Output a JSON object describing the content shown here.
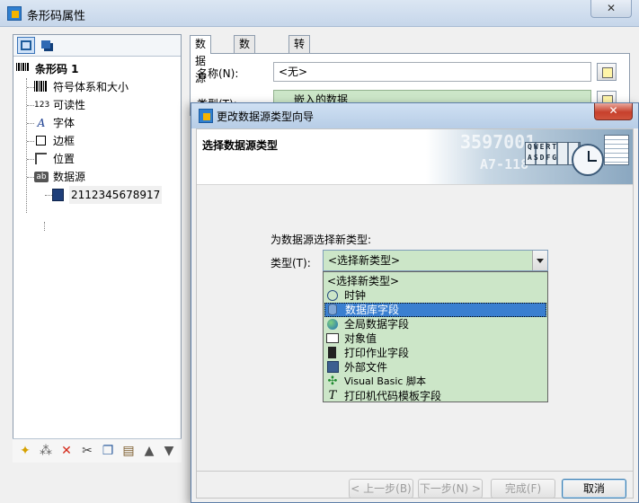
{
  "outer": {
    "title": "条形码属性",
    "close_label": "✕"
  },
  "tree": {
    "root_label": "条形码 1",
    "items": [
      {
        "label": "符号体系和大小"
      },
      {
        "label": "可读性"
      },
      {
        "label": "字体"
      },
      {
        "label": "边框"
      },
      {
        "label": "位置"
      },
      {
        "label": "数据源"
      }
    ],
    "datasource_child": "2112345678917",
    "icon_text": {
      "root": "123",
      "readability": "123",
      "font": "A",
      "datasource": "ab"
    }
  },
  "tabs": [
    "数据源",
    "数据类型",
    "转换"
  ],
  "properties": {
    "name_label": "名称(N):",
    "name_value": "<无>",
    "type_label": "类型(T):",
    "type_value": "嵌入的数据"
  },
  "wizard": {
    "title": "更改数据源类型向导",
    "close_label": "✕",
    "heading": "选择数据源类型",
    "banner_text_1": "3597001",
    "banner_text_2": "A7-118",
    "keyboard_row_1": "QWERT",
    "keyboard_row_2": "ASDFG",
    "prompt": "为数据源选择新类型:",
    "type_label": "类型(T):",
    "selected_value": "<选择新类型>",
    "options": [
      {
        "label": "<选择新类型>",
        "icon": ""
      },
      {
        "label": "时钟",
        "icon": "clock-icon"
      },
      {
        "label": "数据库字段",
        "icon": "database-icon"
      },
      {
        "label": "全局数据字段",
        "icon": "globe-icon"
      },
      {
        "label": "对象值",
        "icon": "object-value-icon"
      },
      {
        "label": "打印作业字段",
        "icon": "print-job-icon"
      },
      {
        "label": "外部文件",
        "icon": "floppy-disk-icon"
      },
      {
        "label": "Visual Basic 脚本",
        "icon": "vb-script-icon"
      },
      {
        "label": "打印机代码模板字段",
        "icon": "printer-code-icon"
      }
    ],
    "buttons": {
      "back": "< 上一步(B)",
      "next": "下一步(N) >",
      "finish": "完成(F)",
      "cancel": "取消"
    }
  },
  "colors": {
    "accent": "#3a7fd0",
    "field_green": "#cce6c8",
    "close_red": "#c7402c"
  }
}
